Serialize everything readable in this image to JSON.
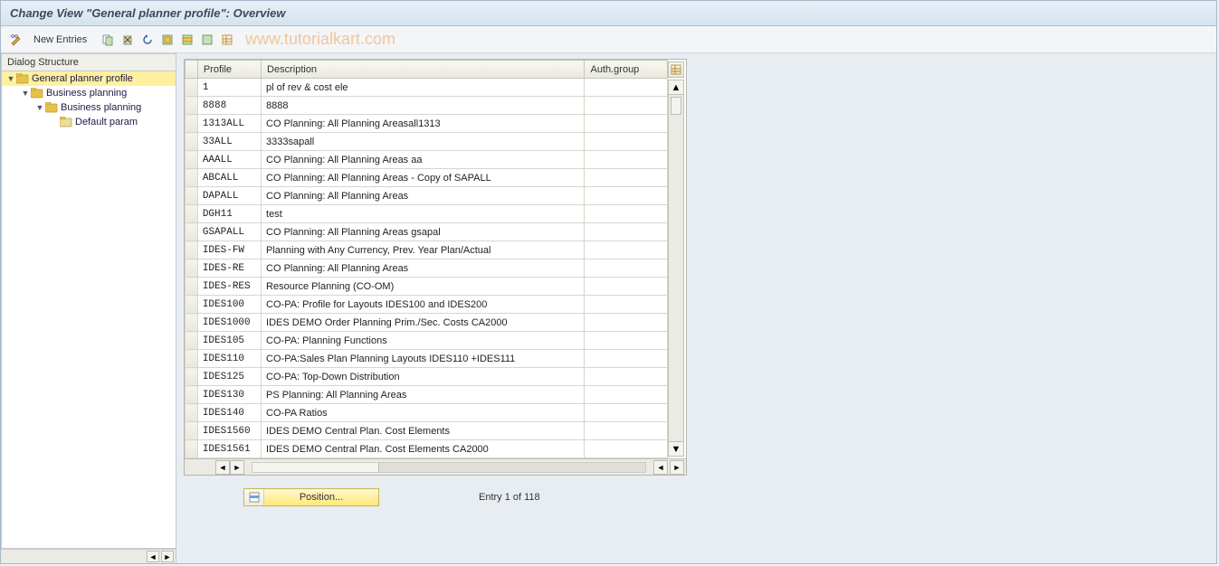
{
  "title": "Change View \"General planner profile\": Overview",
  "watermark": "www.tutorialkart.com",
  "toolbar": {
    "new_entries": "New Entries"
  },
  "dialog_structure": {
    "header": "Dialog Structure",
    "nodes": [
      {
        "label": "General planner profile",
        "level": 0,
        "open": true,
        "selected": true
      },
      {
        "label": "Business planning",
        "level": 1,
        "open": true,
        "selected": false
      },
      {
        "label": "Business planning",
        "level": 2,
        "open": true,
        "selected": false
      },
      {
        "label": "Default param",
        "level": 3,
        "open": false,
        "selected": false
      }
    ]
  },
  "table": {
    "columns": {
      "profile": "Profile",
      "description": "Description",
      "auth_group": "Auth.group"
    },
    "rows": [
      {
        "profile": "1",
        "description": "pl of rev & cost ele",
        "auth": ""
      },
      {
        "profile": "8888",
        "description": "8888",
        "auth": ""
      },
      {
        "profile": "1313ALL",
        "description": "CO Planning: All Planning Areasall1313",
        "auth": ""
      },
      {
        "profile": "33ALL",
        "description": "3333sapall",
        "auth": ""
      },
      {
        "profile": "AAALL",
        "description": "CO Planning: All Planning Areas aa",
        "auth": ""
      },
      {
        "profile": "ABCALL",
        "description": "CO Planning: All Planning Areas - Copy of SAPALL",
        "auth": ""
      },
      {
        "profile": "DAPALL",
        "description": "CO Planning: All Planning Areas",
        "auth": ""
      },
      {
        "profile": "DGH11",
        "description": "test",
        "auth": ""
      },
      {
        "profile": "GSAPALL",
        "description": "CO Planning: All Planning Areas gsapal",
        "auth": ""
      },
      {
        "profile": "IDES-FW",
        "description": "Planning with Any Currency, Prev. Year Plan/Actual",
        "auth": ""
      },
      {
        "profile": "IDES-RE",
        "description": "CO Planning: All Planning Areas",
        "auth": ""
      },
      {
        "profile": "IDES-RES",
        "description": "Resource Planning (CO-OM)",
        "auth": ""
      },
      {
        "profile": "IDES100",
        "description": "CO-PA: Profile for Layouts IDES100 and IDES200",
        "auth": ""
      },
      {
        "profile": "IDES1000",
        "description": "IDES DEMO Order Planning Prim./Sec. Costs   CA2000",
        "auth": ""
      },
      {
        "profile": "IDES105",
        "description": "CO-PA: Planning Functions",
        "auth": ""
      },
      {
        "profile": "IDES110",
        "description": "CO-PA:Sales Plan Planning Layouts IDES110 +IDES111",
        "auth": ""
      },
      {
        "profile": "IDES125",
        "description": "CO-PA: Top-Down Distribution",
        "auth": ""
      },
      {
        "profile": "IDES130",
        "description": "PS Planning: All Planning Areas",
        "auth": ""
      },
      {
        "profile": "IDES140",
        "description": "CO-PA Ratios",
        "auth": ""
      },
      {
        "profile": "IDES1560",
        "description": "IDES DEMO Central Plan. Cost Elements",
        "auth": ""
      },
      {
        "profile": "IDES1561",
        "description": "IDES DEMO Central Plan. Cost Elements       CA2000",
        "auth": ""
      }
    ]
  },
  "footer": {
    "position_label": "Position...",
    "entry_status": "Entry 1 of 118"
  }
}
